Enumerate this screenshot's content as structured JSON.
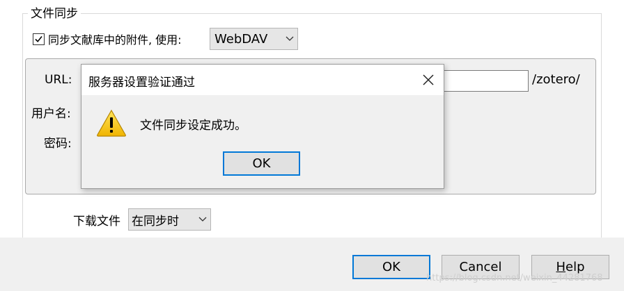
{
  "main": {
    "group_title": "文件同步",
    "sync_label": "同步文献库中的附件, 使用:",
    "sync_checked": true,
    "sync_method": "WebDAV",
    "server": {
      "url_label": "URL:",
      "username_label": "用户名:",
      "password_label": "密码:",
      "url_suffix": "/zotero/"
    },
    "download_label": "下载文件",
    "download_value": "在同步时"
  },
  "buttons": {
    "ok": "OK",
    "cancel": "Cancel",
    "help": "Help"
  },
  "watermark": "https://blog.csdn.net/weixin_44281768",
  "dialog": {
    "title": "服务器设置验证通过",
    "message": "文件同步设定成功。",
    "ok": "OK",
    "icon": "warning-icon"
  },
  "colors": {
    "accent": "#0078d7",
    "dialog_bg": "#f0f0f0",
    "button_bg": "#e1e1e1",
    "warning": "#f5c400"
  }
}
